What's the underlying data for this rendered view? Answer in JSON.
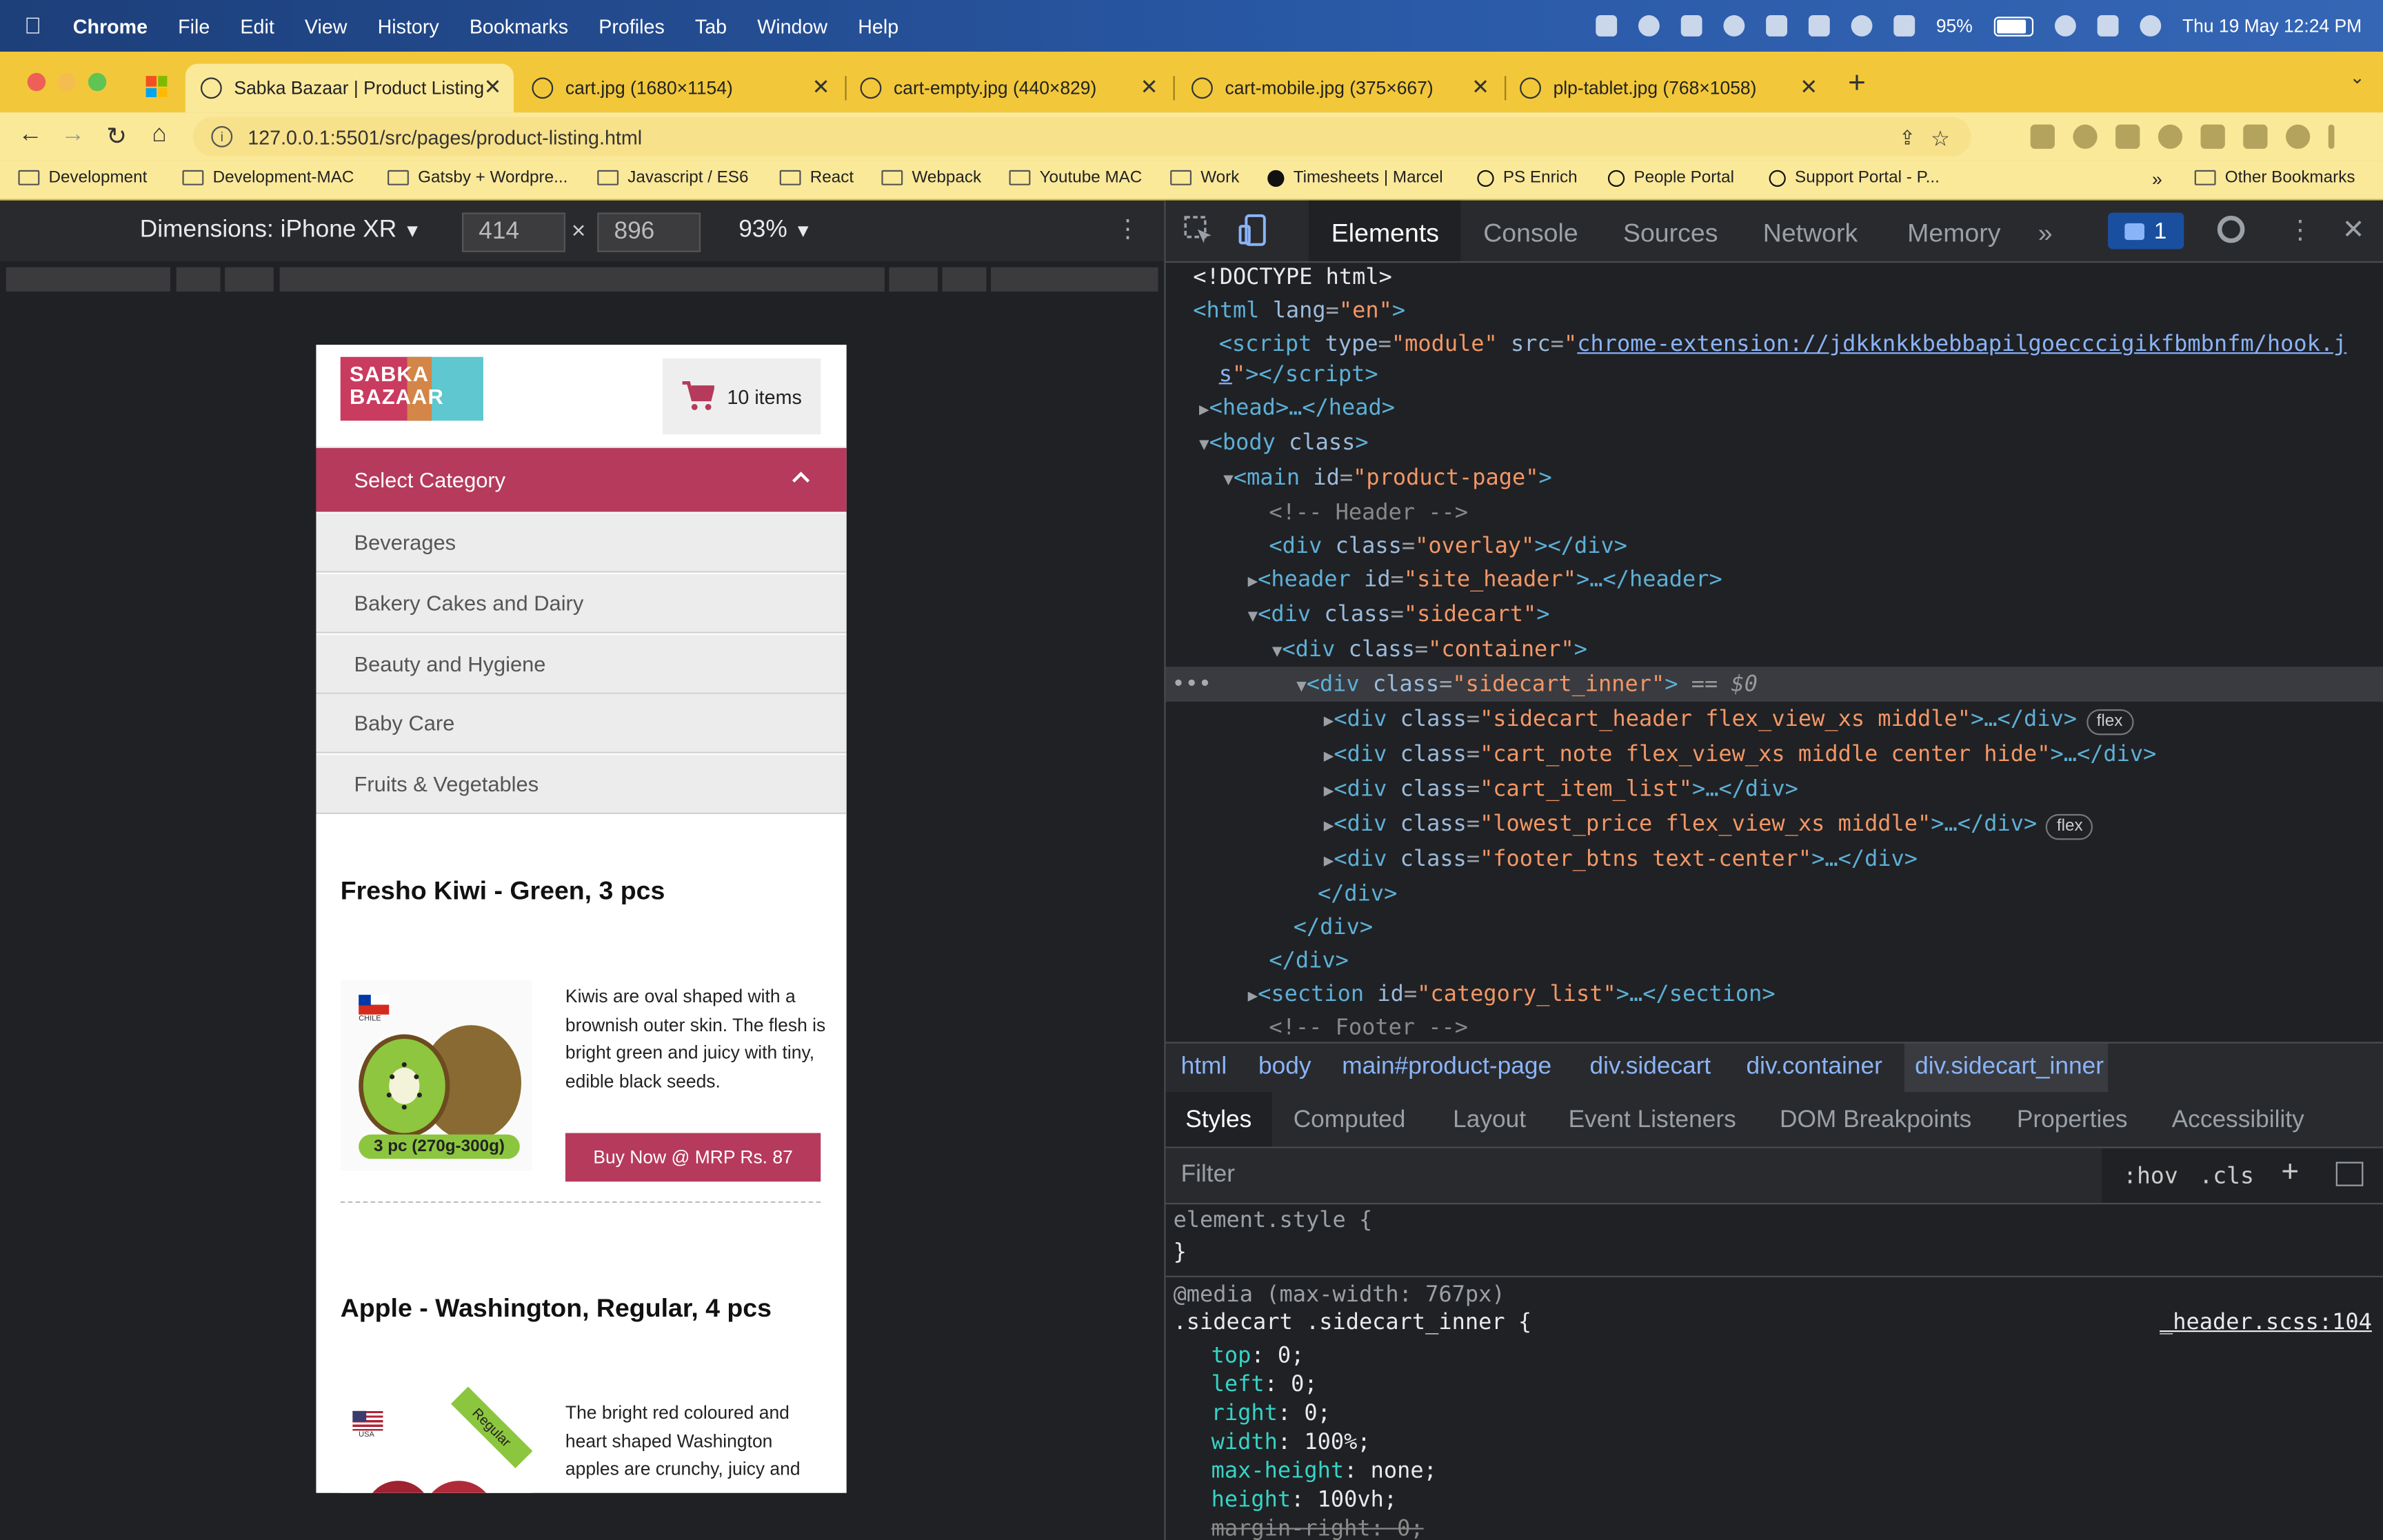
{
  "menubar": {
    "app": "Chrome",
    "items": [
      "File",
      "Edit",
      "View",
      "History",
      "Bookmarks",
      "Profiles",
      "Tab",
      "Window",
      "Help"
    ],
    "battery": "95%",
    "datetime": "Thu 19 May  12:24 PM"
  },
  "tabs": [
    {
      "title": "Sabka Bazaar | Product Listing"
    },
    {
      "title": "cart.jpg (1680×1154)"
    },
    {
      "title": "cart-empty.jpg (440×829)"
    },
    {
      "title": "cart-mobile.jpg (375×667)"
    },
    {
      "title": "plp-tablet.jpg (768×1058)"
    }
  ],
  "address": "127.0.0.1:5501/src/pages/product-listing.html",
  "bookmarks": [
    "Development",
    "Development-MAC",
    "Gatsby + Wordpre...",
    "Javascript / ES6",
    "React",
    "Webpack",
    "Youtube MAC",
    "Work",
    "Timesheets | Marcel",
    "PS Enrich",
    "People Portal",
    "Support Portal - P..."
  ],
  "other_bookmarks": "Other Bookmarks",
  "device_toolbar": {
    "dimensions": "Dimensions: iPhone XR",
    "width": "414",
    "height": "896",
    "zoom": "93%"
  },
  "site": {
    "logo_line1": "SABKA",
    "logo_line2": "BAZAAR",
    "cart_label": "10 items",
    "select_category": "Select Category",
    "categories": [
      "Beverages",
      "Bakery Cakes and Dairy",
      "Beauty and Hygiene",
      "Baby Care",
      "Fruits & Vegetables"
    ],
    "products": [
      {
        "title": "Fresho Kiwi - Green, 3 pcs",
        "description": "Kiwis are oval shaped with a brownish outer skin. The flesh is bright green and juicy with tiny, edible black seeds.",
        "buy": "Buy Now @ MRP Rs. 87",
        "img_tag": "3 pc (270g-300g)",
        "flag_label": "CHILE"
      },
      {
        "title": "Apple - Washington, Regular, 4 pcs",
        "description": "The bright red coloured and heart shaped Washington apples are crunchy, juicy and",
        "img_tag": "Regular",
        "flag_label": "USA"
      }
    ]
  },
  "devtools": {
    "tabs": [
      "Elements",
      "Console",
      "Sources",
      "Network",
      "Memory"
    ],
    "more": "»",
    "badge": "1",
    "dom": {
      "doctype": "<!DOCTYPE html>",
      "html_open_tag": "<html",
      "lang_attr": "lang",
      "lang_val": "\"en\"",
      "script_src": "chrome-extension://jdkknkkbebbapilgoecccigikfbmbnfm/hook.j",
      "script_src_wrap": "s",
      "head": "<head>…</head>",
      "comment_header": "<!-- Header -->",
      "comment_footer": "<!-- Footer -->",
      "selected_suffix": "== $0"
    },
    "breadcrumbs": [
      "html",
      "body",
      "main#product-page",
      "div.sidecart",
      "div.container",
      "div.sidecart_inner"
    ],
    "subtabs": [
      "Styles",
      "Computed",
      "Layout",
      "Event Listeners",
      "DOM Breakpoints",
      "Properties",
      "Accessibility"
    ],
    "filter_placeholder": "Filter",
    "filter_hov": ":hov",
    "filter_cls": ".cls",
    "styles": {
      "element_style": "element.style {",
      "close": "}",
      "media": "@media (max-width: 767px)",
      "selector": ".sidecart .sidecart_inner {",
      "source": "_header.scss:104",
      "props": [
        {
          "name": "top",
          "value": "0;"
        },
        {
          "name": "left",
          "value": "0;"
        },
        {
          "name": "right",
          "value": "0;"
        },
        {
          "name": "width",
          "value": "100%;"
        },
        {
          "name": "max-height",
          "value": "none;"
        },
        {
          "name": "height",
          "value": "100vh;"
        },
        {
          "name": "margin-right",
          "value": "0;"
        }
      ]
    }
  }
}
